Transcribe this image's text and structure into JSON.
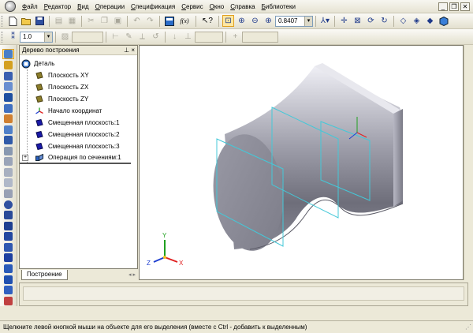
{
  "app": {
    "icon": "kompas-app-icon"
  },
  "menu": {
    "items": [
      "Файл",
      "Редактор",
      "Вид",
      "Операции",
      "Спецификация",
      "Сервис",
      "Окно",
      "Справка",
      "Библиотеки"
    ]
  },
  "window_controls": {
    "minimize": "_",
    "restore": "❐",
    "close": "✕"
  },
  "toolbar1": {
    "fx_label": "f(x)",
    "zoom_value": "0.8407"
  },
  "toolbar2": {
    "scale_value": "1.0"
  },
  "tree_panel": {
    "title": "Дерево построения",
    "pin": "⊥ ×",
    "root": "Деталь",
    "items": [
      {
        "label": "Плоскость XY",
        "icon": "plane-icon"
      },
      {
        "label": "Плоскость ZX",
        "icon": "plane-icon"
      },
      {
        "label": "Плоскость ZY",
        "icon": "plane-icon"
      },
      {
        "label": "Начало координат",
        "icon": "origin-icon"
      },
      {
        "label": "Смещенная плоскость:1",
        "icon": "offset-plane-icon"
      },
      {
        "label": "Смещенная плоскость:2",
        "icon": "offset-plane-icon"
      },
      {
        "label": "Смещенная плоскость:3",
        "icon": "offset-plane-icon"
      },
      {
        "label": "Операция по сечениям:1",
        "icon": "loft-operation-icon"
      }
    ],
    "tab": "Построение"
  },
  "viewport": {
    "axis_x": "X",
    "axis_y": "Y",
    "axis_z": "Z"
  },
  "statusbar": {
    "text": "Щелкните левой кнопкой мыши на объекте для его выделения (вместе с Ctrl - добавить к выделенным)"
  },
  "colors": {
    "plane_icon": "#8b7d2a",
    "offset_plane_icon": "#1a1aa8",
    "axis_x": "#e02020",
    "axis_y": "#20a020",
    "axis_z": "#2040d0",
    "section_lines": "#44c8d8"
  }
}
